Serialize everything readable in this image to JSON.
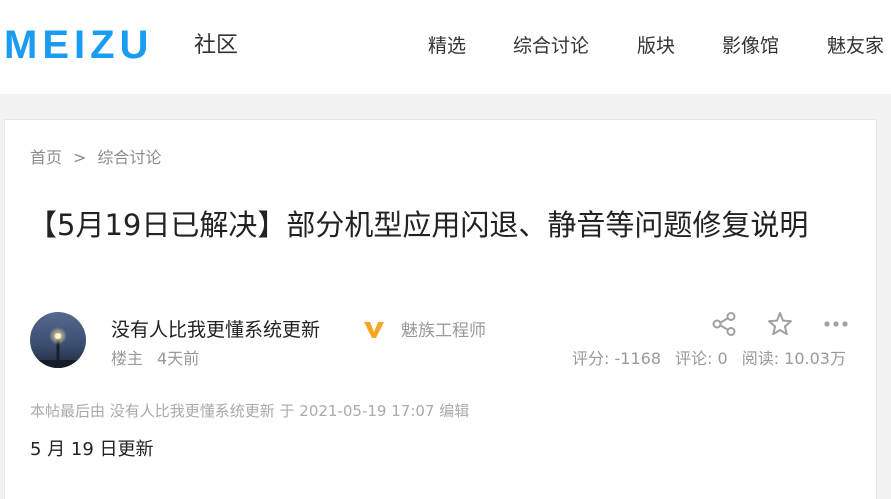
{
  "header": {
    "logo": "MEIZU",
    "logo_sub": "社区",
    "nav": [
      "精选",
      "综合讨论",
      "版块",
      "影像馆",
      "魅友家"
    ]
  },
  "breadcrumb": {
    "home": "首页",
    "separator": ">",
    "section": "综合讨论"
  },
  "post": {
    "title": "【5月19日已解决】部分机型应用闪退、静音等问题修复说明",
    "author": "没有人比我更懂系统更新",
    "badge_icon": "v-verified-icon",
    "role": "魅族工程师",
    "floor": "楼主",
    "time": "4天前",
    "actions": [
      "share-icon",
      "star-icon",
      "more-icon"
    ],
    "stats": {
      "score": "评分: -1168",
      "comments": "评论: 0",
      "reads": "阅读: 10.03万"
    },
    "edited_note": "本帖最后由 没有人比我更懂系统更新 于 2021-05-19 17:07 编辑",
    "content_first_line": "5 月 19 日更新"
  },
  "colors": {
    "brand": "#1a9cf2",
    "badge": "#f5a623",
    "muted": "#999999",
    "page_bg": "#f2f2f2"
  }
}
